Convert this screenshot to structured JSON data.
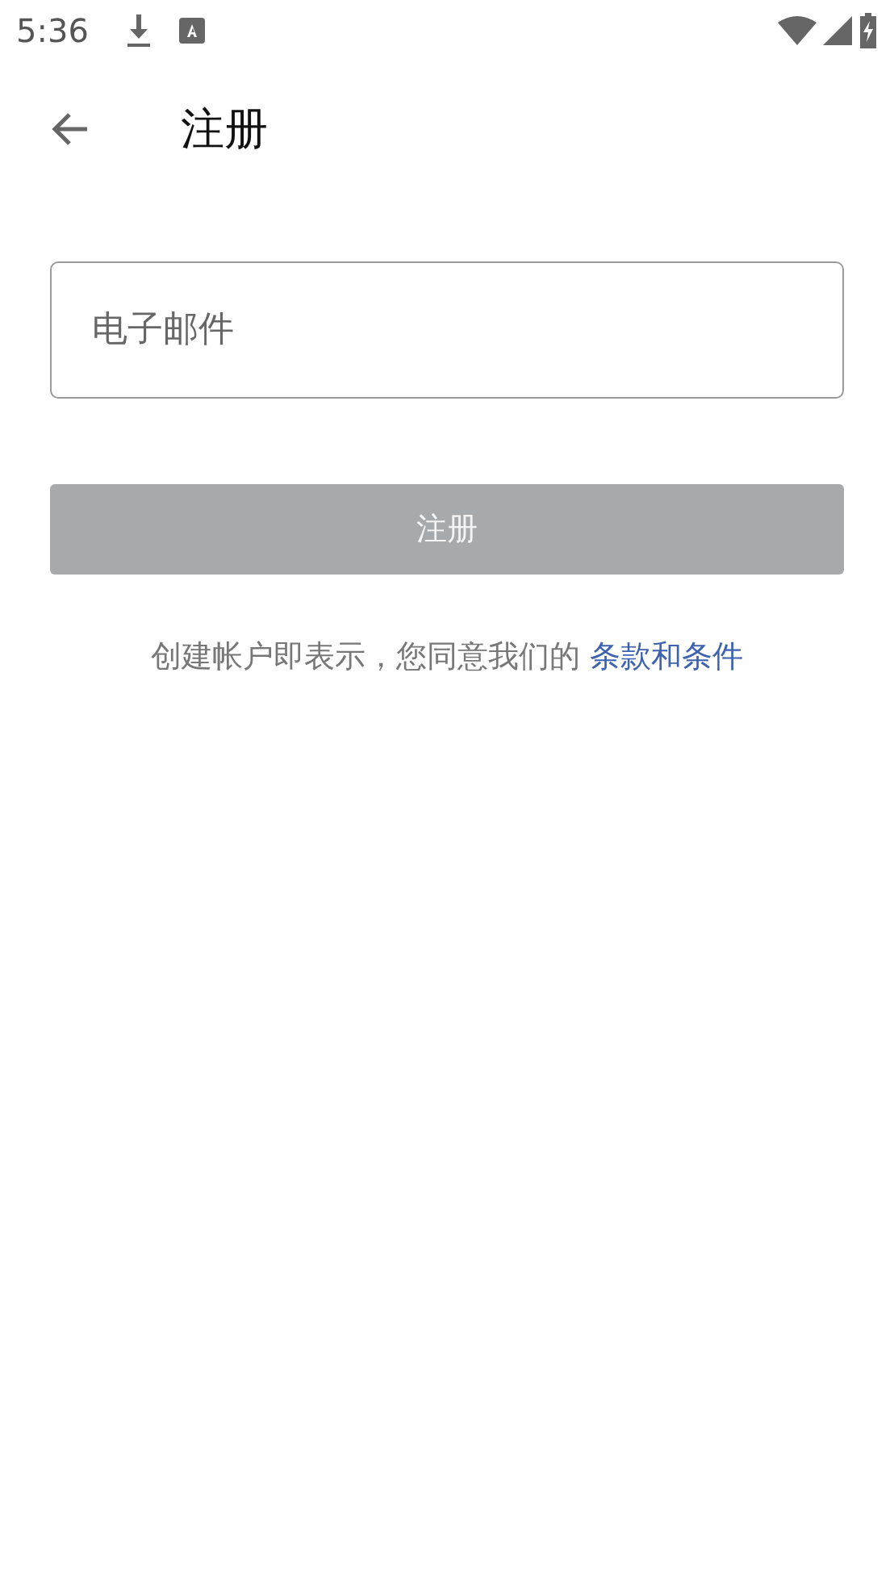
{
  "status_bar": {
    "time": "5:36"
  },
  "app_bar": {
    "title": "注册"
  },
  "email_field": {
    "placeholder": "电子邮件"
  },
  "register_button": {
    "label": "注册",
    "disabled": true
  },
  "terms": {
    "text": "创建帐户即表示，您同意我们的",
    "link": "条款和条件"
  }
}
